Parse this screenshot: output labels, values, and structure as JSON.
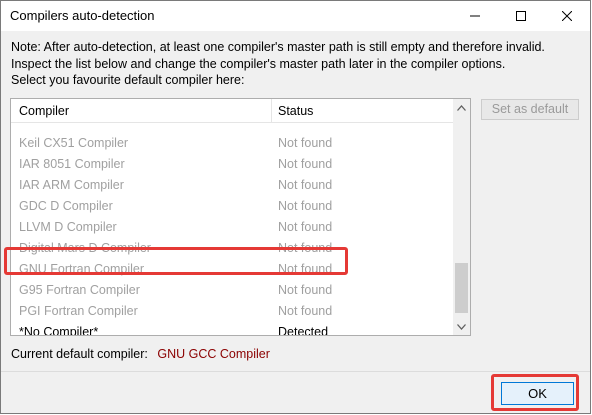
{
  "window": {
    "title": "Compilers auto-detection"
  },
  "note_lines": [
    "Note: After auto-detection, at least one compiler's master path is still empty and therefore invalid.",
    "Inspect the list below and change the compiler's master path later in the compiler options.",
    "Select you favourite default compiler here:"
  ],
  "list": {
    "headers": {
      "compiler": "Compiler",
      "status": "Status"
    },
    "rows": [
      {
        "compiler": "Keil CX51 Compiler",
        "status": "Not found"
      },
      {
        "compiler": "IAR 8051 Compiler",
        "status": "Not found"
      },
      {
        "compiler": "IAR ARM Compiler",
        "status": "Not found"
      },
      {
        "compiler": "GDC D Compiler",
        "status": "Not found"
      },
      {
        "compiler": "LLVM D Compiler",
        "status": "Not found"
      },
      {
        "compiler": "Digital Mars D Compiler",
        "status": "Not found"
      },
      {
        "compiler": "GNU Fortran Compiler",
        "status": "Not found"
      },
      {
        "compiler": "G95 Fortran Compiler",
        "status": "Not found"
      },
      {
        "compiler": "PGI Fortran Compiler",
        "status": "Not found"
      },
      {
        "compiler": "*No Compiler*",
        "status": "Detected"
      }
    ]
  },
  "buttons": {
    "set_default": "Set as default",
    "ok": "OK"
  },
  "current_default": {
    "label": "Current default compiler:",
    "value": "GNU GCC Compiler"
  },
  "colors": {
    "highlight": "#e53935",
    "current_value": "#8b0000",
    "disabled_text": "#a0a0a0"
  }
}
